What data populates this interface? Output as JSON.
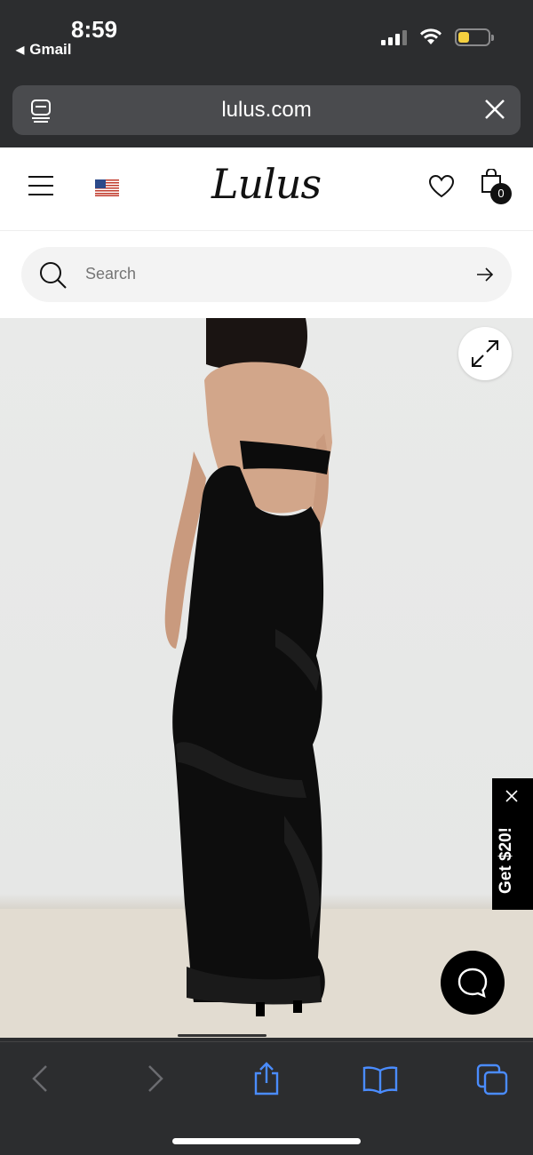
{
  "status_bar": {
    "time": "8:59",
    "back_app": "Gmail"
  },
  "browser": {
    "url": "lulus.com"
  },
  "site": {
    "logo": "Lulus",
    "cart_count": "0"
  },
  "search": {
    "placeholder": "Search"
  },
  "promo": {
    "label": "Get $20!"
  },
  "colors": {
    "accent": "#000000",
    "browser_chrome": "#2c2d2f",
    "ios_blue": "#4a8cff",
    "battery": "#f4d03f"
  }
}
